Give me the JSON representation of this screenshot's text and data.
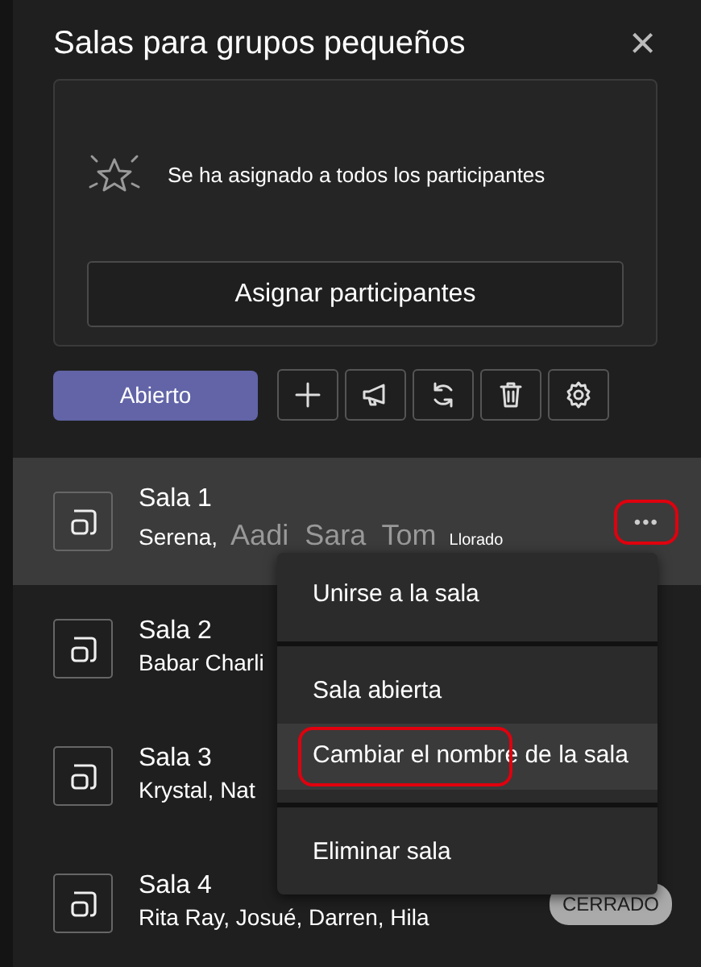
{
  "panel": {
    "title": "Salas para grupos pequeños",
    "close": "×"
  },
  "assigned_card": {
    "message": "Se ha asignado a todos los participantes",
    "button": "Asignar participantes"
  },
  "toolbar": {
    "primary": "Abierto",
    "tools": [
      {
        "kind": "add"
      },
      {
        "kind": "announce"
      },
      {
        "kind": "recreate"
      },
      {
        "kind": "delete"
      },
      {
        "kind": "settings"
      }
    ]
  },
  "rooms": [
    {
      "name": "Sala 1",
      "participants": "Serena,",
      "extra_names": "Aadi  Sara  Tom",
      "extra_label": "Llorado",
      "selected": true,
      "more": "•••",
      "more_annotated": true
    },
    {
      "name": "Sala 2",
      "participants": "Babar Charli",
      "selected": false
    },
    {
      "name": "Sala 3",
      "participants": "Krystal, Nat",
      "selected": false
    },
    {
      "name": "Sala 4",
      "participants": "Rita Ray, Josué, Darren, Hila",
      "selected": false,
      "status": "CERRADO"
    }
  ],
  "menu": [
    {
      "label": "Unirse a la sala",
      "selected": false,
      "divider_after": true
    },
    {
      "label": "Sala abierta",
      "selected": false
    },
    {
      "label": "Cambiar el nombre de la sala",
      "selected": true,
      "annotated": true,
      "divider_after": true
    },
    {
      "label": "Eliminar sala",
      "selected": false
    }
  ]
}
